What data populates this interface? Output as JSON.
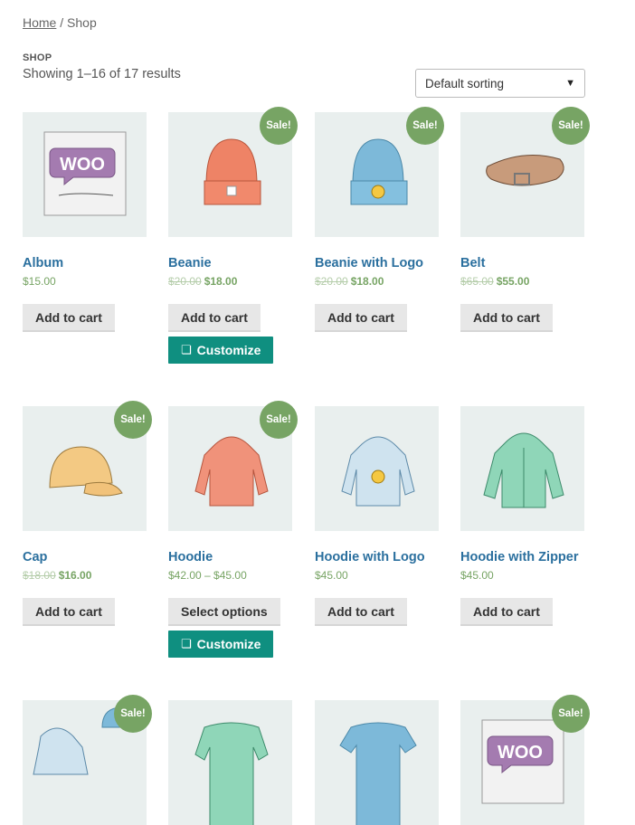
{
  "breadcrumb": {
    "home": "Home",
    "sep": " / ",
    "current": "Shop"
  },
  "page": {
    "heading": "SHOP",
    "result_count": "Showing 1–16 of 17 results"
  },
  "sorting": {
    "selected": "Default sorting"
  },
  "labels": {
    "sale": "Sale!",
    "customize": "Customize"
  },
  "products": [
    {
      "name": "Album",
      "price": "$15.00",
      "button": "Add to cart",
      "icon": "album-icon"
    },
    {
      "name": "Beanie",
      "old_price": "$20.00",
      "price": "$18.00",
      "sale": true,
      "button": "Add to cart",
      "customize": true,
      "icon": "beanie-icon"
    },
    {
      "name": "Beanie with Logo",
      "old_price": "$20.00",
      "price": "$18.00",
      "sale": true,
      "button": "Add to cart",
      "icon": "beanie-logo-icon"
    },
    {
      "name": "Belt",
      "old_price": "$65.00",
      "price": "$55.00",
      "sale": true,
      "button": "Add to cart",
      "icon": "belt-icon"
    },
    {
      "name": "Cap",
      "old_price": "$18.00",
      "price": "$16.00",
      "sale": true,
      "button": "Add to cart",
      "icon": "cap-icon"
    },
    {
      "name": "Hoodie",
      "price": "$42.00 – $45.00",
      "sale": true,
      "button": "Select options",
      "customize": true,
      "icon": "hoodie-icon"
    },
    {
      "name": "Hoodie with Logo",
      "price": "$45.00",
      "button": "Add to cart",
      "icon": "hoodie-logo-icon"
    },
    {
      "name": "Hoodie with Zipper",
      "price": "$45.00",
      "button": "Add to cart",
      "icon": "hoodie-zipper-icon"
    },
    {
      "sale": true,
      "icon": "hoodies-bundle-icon"
    },
    {
      "icon": "long-sleeve-tee-icon"
    },
    {
      "icon": "polo-icon"
    },
    {
      "sale": true,
      "icon": "album-single-icon"
    }
  ],
  "colors": {
    "link": "#2a6f9e",
    "sale": "#77a464",
    "customize": "#0f8f80",
    "thumb_bg": "#e9efee"
  }
}
